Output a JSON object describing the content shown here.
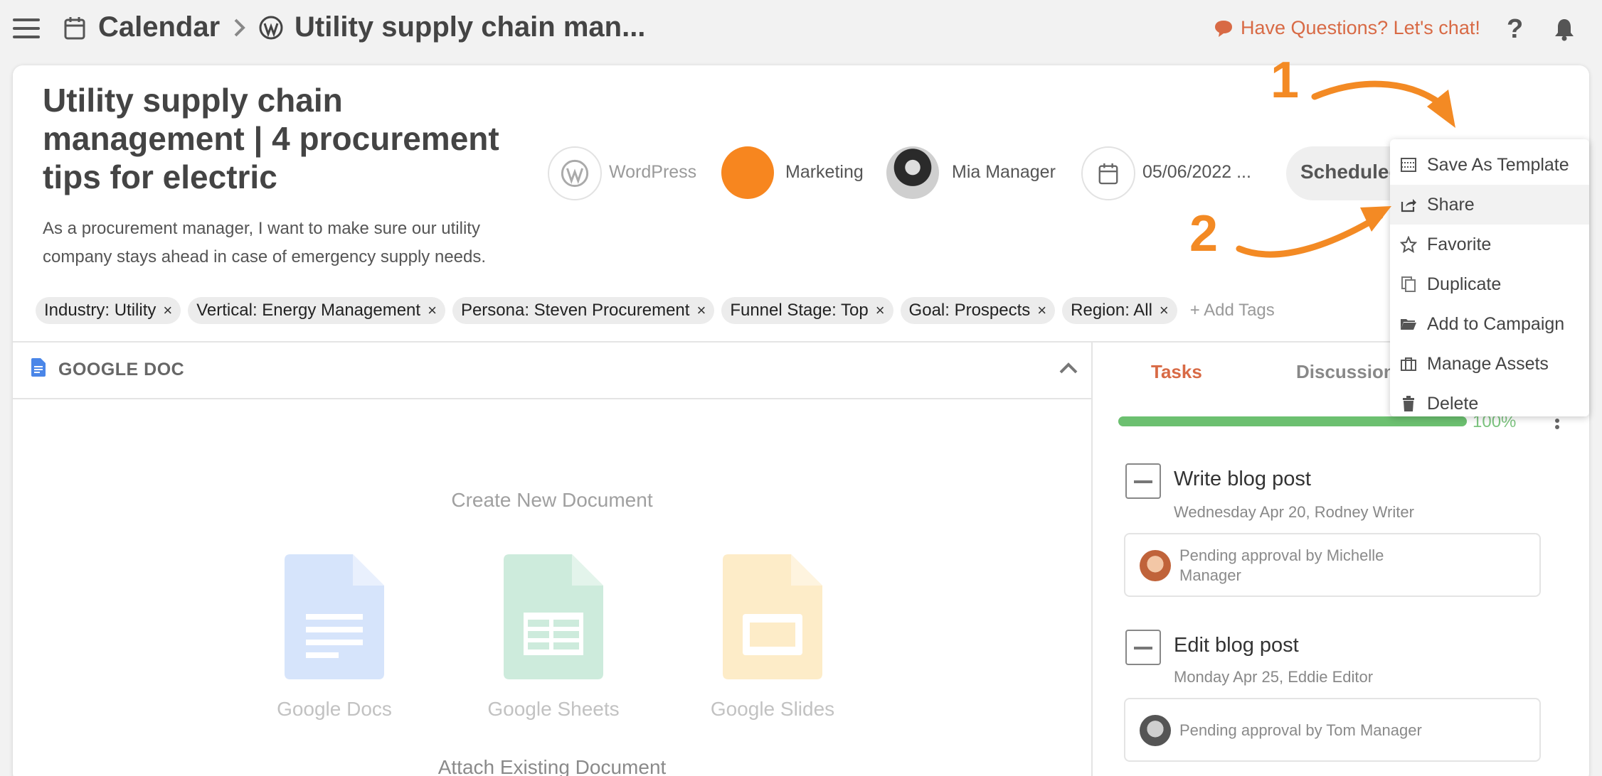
{
  "topbar": {
    "breadcrumb_calendar": "Calendar",
    "breadcrumb_title": "Utility supply chain man...",
    "chat_link": "Have Questions? Let's chat!",
    "help": "?"
  },
  "card": {
    "title": "Utility supply chain management | 4 procurement tips for electric",
    "description": "As a procurement manager, I want to make sure our utility company stays ahead in case of emergency supply needs.",
    "meta": {
      "channel": "WordPress",
      "team": "Marketing",
      "owner": "Mia Manager",
      "date": "05/06/2022 ...",
      "status": "Scheduled"
    },
    "tags": [
      "Industry: Utility",
      "Vertical: Energy Management",
      "Persona: Steven Procurement",
      "Funnel Stage: Top",
      "Goal: Prospects",
      "Region: All"
    ],
    "tag_remove_symbol": "×",
    "add_tags": "+ Add Tags"
  },
  "google_doc": {
    "header": "GOOGLE DOC",
    "create_new": "Create New Document",
    "options": [
      "Google Docs",
      "Google Sheets",
      "Google Slides"
    ],
    "attach_existing": "Attach Existing Document"
  },
  "right_panel": {
    "tabs": [
      "Tasks",
      "Discussion"
    ],
    "progress_fraction": 1.0,
    "progress_label": "100%",
    "tasks": [
      {
        "title": "Write blog post",
        "meta": "Wednesday Apr 20,  Rodney Writer",
        "approval": "Pending approval by Michelle Manager"
      },
      {
        "title": "Edit blog post",
        "meta": "Monday Apr 25,  Eddie Editor",
        "approval": "Pending approval by Tom Manager"
      }
    ]
  },
  "menu": {
    "items": [
      {
        "label": "Save As Template",
        "icon": "template-icon"
      },
      {
        "label": "Share",
        "icon": "share-icon"
      },
      {
        "label": "Favorite",
        "icon": "star-icon"
      },
      {
        "label": "Duplicate",
        "icon": "duplicate-icon"
      },
      {
        "label": "Add to Campaign",
        "icon": "folder-icon"
      },
      {
        "label": "Manage Assets",
        "icon": "briefcase-icon"
      },
      {
        "label": "Delete",
        "icon": "trash-icon"
      }
    ],
    "highlighted_item": "Share"
  },
  "annotations": {
    "step1": "1",
    "step2": "2",
    "color": "#f38a24"
  },
  "colors": {
    "accent": "#d86a45",
    "team_dot": "#f7861f",
    "progress": "#6cc070",
    "docs": "#d6e4fb",
    "sheets": "#cdebdc",
    "slides": "#fdecc8"
  }
}
